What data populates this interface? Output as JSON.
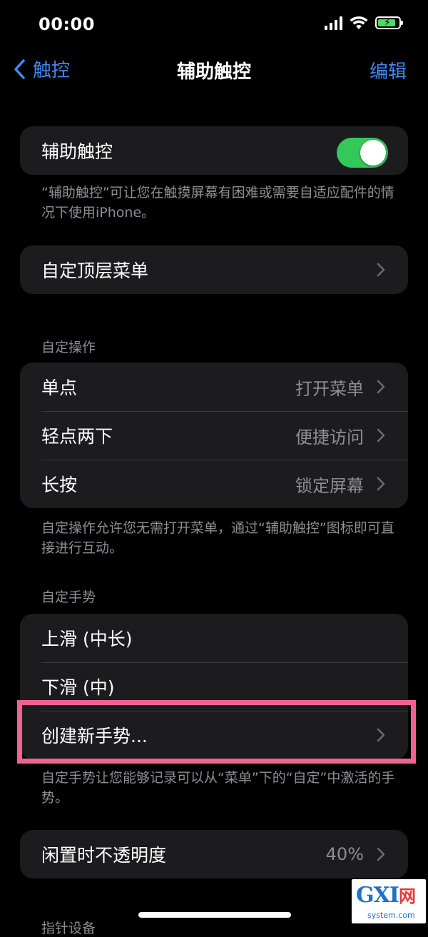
{
  "status_bar": {
    "time": "00:00"
  },
  "nav": {
    "back_label": "触控",
    "title": "辅助触控",
    "edit_label": "编辑"
  },
  "toggle_group": {
    "label": "辅助触控",
    "enabled": true
  },
  "toggle_footnote": "“辅助触控”可让您在触摸屏幕有困难或需要自适应配件的情况下使用iPhone。",
  "top_menu": {
    "label": "自定顶层菜单"
  },
  "custom_actions": {
    "header": "自定操作",
    "items": [
      {
        "label": "单点",
        "value": "打开菜单"
      },
      {
        "label": "轻点两下",
        "value": "便捷访问"
      },
      {
        "label": "长按",
        "value": "锁定屏幕"
      }
    ],
    "footnote": "自定操作允许您无需打开菜单，通过“辅助触控”图标即可直接进行互动。"
  },
  "custom_gestures": {
    "header": "自定手势",
    "items": [
      {
        "label": "上滑 (中长)"
      },
      {
        "label": "下滑 (中)"
      },
      {
        "label": "创建新手势..."
      }
    ],
    "footnote": "自定手势让您能够记录可以从“菜单”下的“自定”中激活的手势。"
  },
  "idle_opacity": {
    "label": "闲置时不透明度",
    "value": "40%"
  },
  "next_section_partial": "指针设备",
  "watermark": {
    "main": "GXI",
    "net": "网",
    "sub": "system.com"
  },
  "colors": {
    "accent": "#3d8bf7",
    "toggle_on": "#34c759",
    "highlight": "#f06292",
    "cell_bg": "#1c1c1e"
  }
}
